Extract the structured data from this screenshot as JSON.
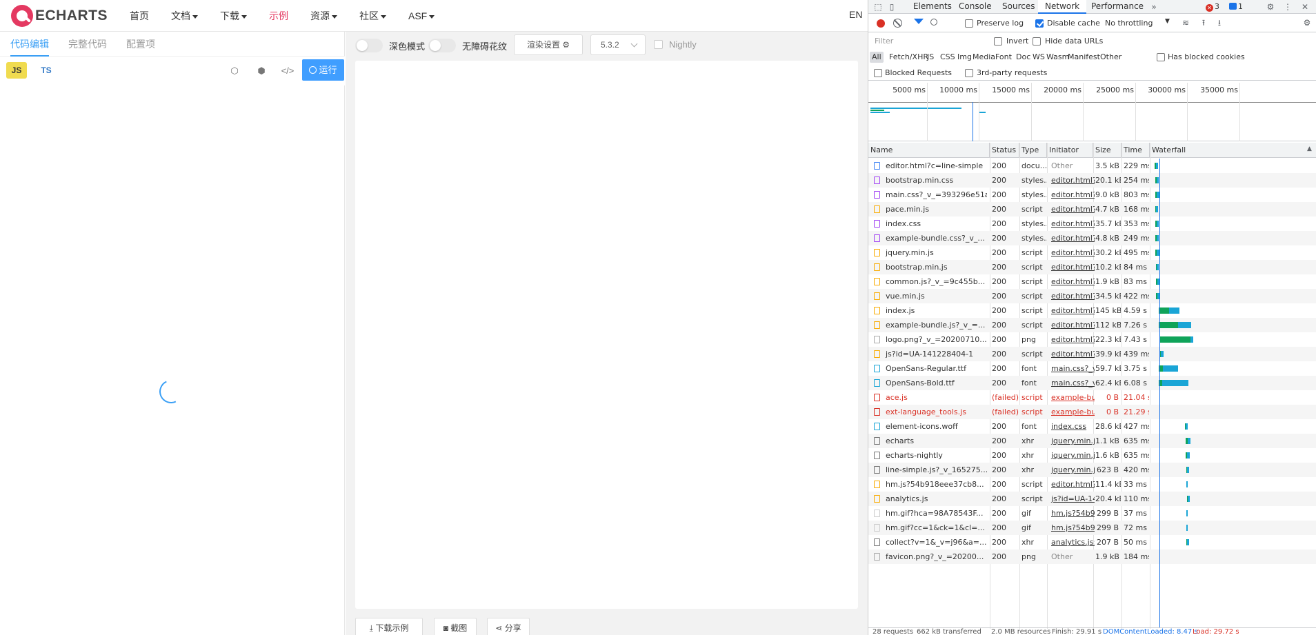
{
  "site": {
    "logo_text": "ECHARTS",
    "nav": [
      {
        "label": "首页",
        "dropdown": false,
        "active": false
      },
      {
        "label": "文档",
        "dropdown": true,
        "active": false
      },
      {
        "label": "下载",
        "dropdown": true,
        "active": false
      },
      {
        "label": "示例",
        "dropdown": false,
        "active": true
      },
      {
        "label": "资源",
        "dropdown": true,
        "active": false
      },
      {
        "label": "社区",
        "dropdown": true,
        "active": false
      },
      {
        "label": "ASF",
        "dropdown": true,
        "active": false
      }
    ],
    "lang": "EN",
    "editor_tabs": [
      "代码编辑",
      "完整代码",
      "配置项"
    ],
    "js_label": "JS",
    "ts_label": "TS",
    "run_label": "运行",
    "dark_mode_label": "深色模式",
    "decal_label": "无障碍花纹",
    "render_settings_label": "渲染设置",
    "version": "5.3.2",
    "nightly_label": "Nightly",
    "download_label": "下载示例",
    "screenshot_label": "截图",
    "share_label": "分享"
  },
  "devtools": {
    "tabs": [
      "Elements",
      "Console",
      "Sources",
      "Network",
      "Performance"
    ],
    "active_tab": "Network",
    "error_count": "3",
    "message_count": "1",
    "toolbar": {
      "preserve_log": "Preserve log",
      "disable_cache": "Disable cache",
      "throttling": "No throttling"
    },
    "filter_placeholder": "Filter",
    "invert_label": "Invert",
    "hide_data_urls_label": "Hide data URLs",
    "types": [
      "All",
      "Fetch/XHR",
      "JS",
      "CSS",
      "Img",
      "Media",
      "Font",
      "Doc",
      "WS",
      "Wasm",
      "Manifest",
      "Other"
    ],
    "blocked_cookies_label": "Has blocked cookies",
    "blocked_requests_label": "Blocked Requests",
    "third_party_label": "3rd-party requests",
    "overview_ticks": [
      "5000 ms",
      "10000 ms",
      "15000 ms",
      "20000 ms",
      "25000 ms",
      "30000 ms",
      "35000 ms"
    ],
    "columns": [
      "Name",
      "Status",
      "Type",
      "Initiator",
      "Size",
      "Time",
      "Waterfall"
    ],
    "requests": [
      {
        "name": "editor.html?c=line-simple",
        "status": "200",
        "type": "docu...",
        "initiator": "Other",
        "size": "3.5 kB",
        "time": "229 ms",
        "kind": "doc"
      },
      {
        "name": "bootstrap.min.css",
        "status": "200",
        "type": "styles...",
        "initiator": "editor.html?...",
        "size": "20.1 kB",
        "time": "254 ms",
        "kind": "css"
      },
      {
        "name": "main.css?_v_=393296e51a",
        "status": "200",
        "type": "styles...",
        "initiator": "editor.html?...",
        "size": "9.0 kB",
        "time": "803 ms",
        "kind": "css"
      },
      {
        "name": "pace.min.js",
        "status": "200",
        "type": "script",
        "initiator": "editor.html?...",
        "size": "4.7 kB",
        "time": "168 ms",
        "kind": "js"
      },
      {
        "name": "index.css",
        "status": "200",
        "type": "styles...",
        "initiator": "editor.html?...",
        "size": "35.7 kB",
        "time": "353 ms",
        "kind": "css"
      },
      {
        "name": "example-bundle.css?_v_...",
        "status": "200",
        "type": "styles...",
        "initiator": "editor.html?...",
        "size": "4.8 kB",
        "time": "249 ms",
        "kind": "css"
      },
      {
        "name": "jquery.min.js",
        "status": "200",
        "type": "script",
        "initiator": "editor.html?...",
        "size": "30.2 kB",
        "time": "495 ms",
        "kind": "js"
      },
      {
        "name": "bootstrap.min.js",
        "status": "200",
        "type": "script",
        "initiator": "editor.html?...",
        "size": "10.2 kB",
        "time": "84 ms",
        "kind": "js"
      },
      {
        "name": "common.js?_v_=9c455b...",
        "status": "200",
        "type": "script",
        "initiator": "editor.html?...",
        "size": "1.9 kB",
        "time": "83 ms",
        "kind": "js"
      },
      {
        "name": "vue.min.js",
        "status": "200",
        "type": "script",
        "initiator": "editor.html?...",
        "size": "34.5 kB",
        "time": "422 ms",
        "kind": "js"
      },
      {
        "name": "index.js",
        "status": "200",
        "type": "script",
        "initiator": "editor.html?...",
        "size": "145 kB",
        "time": "4.59 s",
        "kind": "js"
      },
      {
        "name": "example-bundle.js?_v_=...",
        "status": "200",
        "type": "script",
        "initiator": "editor.html?...",
        "size": "112 kB",
        "time": "7.26 s",
        "kind": "js"
      },
      {
        "name": "logo.png?_v_=20200710...",
        "status": "200",
        "type": "png",
        "initiator": "editor.html?...",
        "size": "22.3 kB",
        "time": "7.43 s",
        "kind": "img"
      },
      {
        "name": "js?id=UA-141228404-1",
        "status": "200",
        "type": "script",
        "initiator": "editor.html?...",
        "size": "39.9 kB",
        "time": "439 ms",
        "kind": "js"
      },
      {
        "name": "OpenSans-Regular.ttf",
        "status": "200",
        "type": "font",
        "initiator": "main.css?_v...",
        "size": "59.7 kB",
        "time": "3.75 s",
        "kind": "font"
      },
      {
        "name": "OpenSans-Bold.ttf",
        "status": "200",
        "type": "font",
        "initiator": "main.css?_v...",
        "size": "62.4 kB",
        "time": "6.08 s",
        "kind": "font"
      },
      {
        "name": "ace.js",
        "status": "(failed)",
        "type": "script",
        "initiator": "example-bu...",
        "size": "0 B",
        "time": "21.04 s",
        "kind": "fail"
      },
      {
        "name": "ext-language_tools.js",
        "status": "(failed)",
        "type": "script",
        "initiator": "example-bu...",
        "size": "0 B",
        "time": "21.29 s",
        "kind": "fail"
      },
      {
        "name": "element-icons.woff",
        "status": "200",
        "type": "font",
        "initiator": "index.css",
        "size": "28.6 kB",
        "time": "427 ms",
        "kind": "font"
      },
      {
        "name": "echarts",
        "status": "200",
        "type": "xhr",
        "initiator": "jquery.min.j...",
        "size": "1.1 kB",
        "time": "635 ms",
        "kind": "xhr"
      },
      {
        "name": "echarts-nightly",
        "status": "200",
        "type": "xhr",
        "initiator": "jquery.min.j...",
        "size": "1.6 kB",
        "time": "635 ms",
        "kind": "xhr"
      },
      {
        "name": "line-simple.js?_v_165275...",
        "status": "200",
        "type": "xhr",
        "initiator": "jquery.min.j...",
        "size": "623 B",
        "time": "420 ms",
        "kind": "xhr"
      },
      {
        "name": "hm.js?54b918eee37cb8...",
        "status": "200",
        "type": "script",
        "initiator": "editor.html?...",
        "size": "11.4 kB",
        "time": "33 ms",
        "kind": "js"
      },
      {
        "name": "analytics.js",
        "status": "200",
        "type": "script",
        "initiator": "js?id=UA-14...",
        "size": "20.4 kB",
        "time": "110 ms",
        "kind": "js"
      },
      {
        "name": "hm.gif?hca=98A78543F...",
        "status": "200",
        "type": "gif",
        "initiator": "hm.js?54b9...",
        "size": "299 B",
        "time": "37 ms",
        "kind": "gif"
      },
      {
        "name": "hm.gif?cc=1&ck=1&cl=...",
        "status": "200",
        "type": "gif",
        "initiator": "hm.js?54b9...",
        "size": "299 B",
        "time": "72 ms",
        "kind": "gif"
      },
      {
        "name": "collect?v=1&_v=j96&a=...",
        "status": "200",
        "type": "xhr",
        "initiator": "analytics.js:44",
        "size": "207 B",
        "time": "50 ms",
        "kind": "xhr"
      },
      {
        "name": "favicon.png?_v_=20200...",
        "status": "200",
        "type": "png",
        "initiator": "Other",
        "size": "1.9 kB",
        "time": "184 ms",
        "kind": "img"
      }
    ],
    "statusbar": {
      "requests": "28 requests",
      "transferred": "662 kB transferred",
      "resources": "2.0 MB resources",
      "finish": "Finish: 29.91 s",
      "dcl": "DOMContentLoaded: 8.47 s",
      "load": "Load: 29.72 s"
    },
    "colors": {
      "accent": "#1a73e8",
      "error": "#d93025",
      "waterfall_wait": "#0fa359",
      "waterfall_download": "#1aa5d6"
    }
  }
}
